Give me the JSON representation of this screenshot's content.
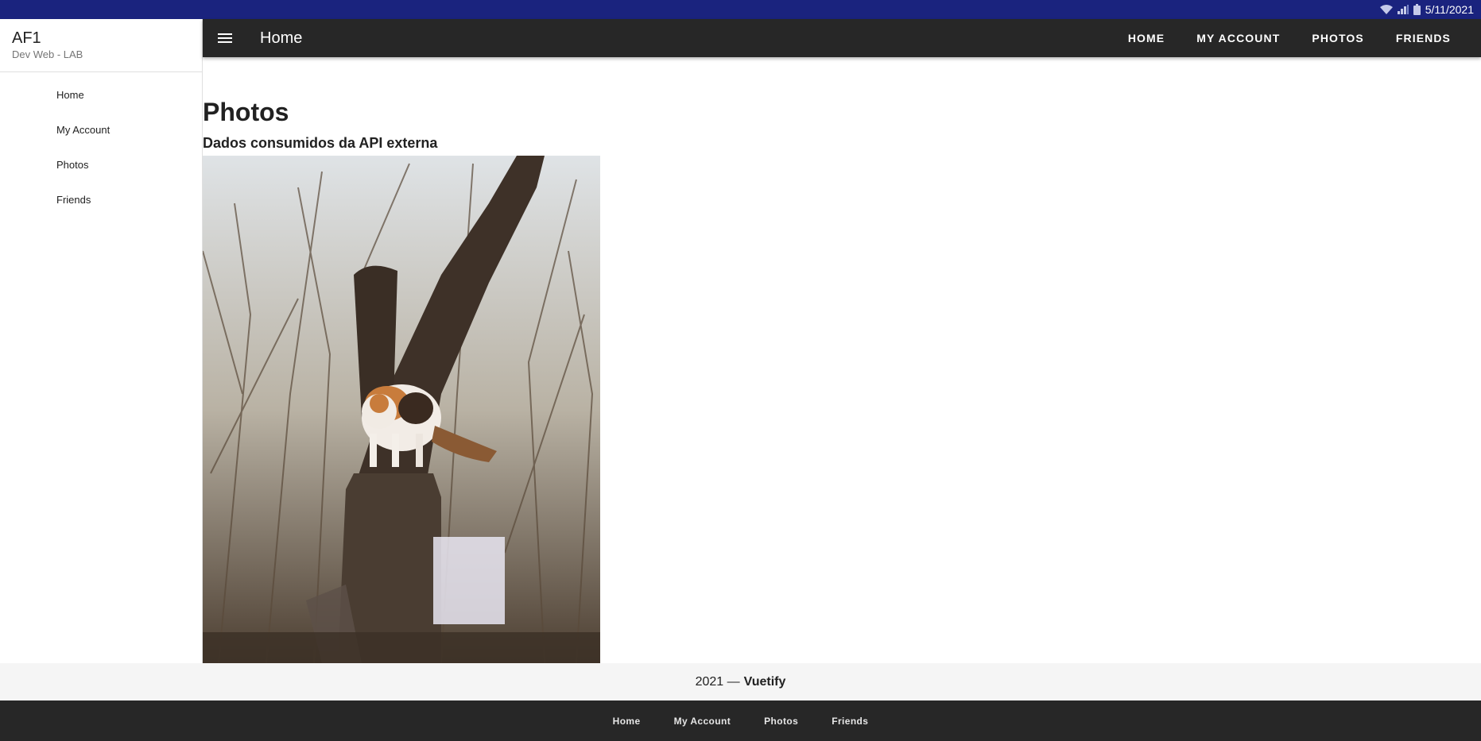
{
  "status_bar": {
    "date": "5/11/2021",
    "icons": [
      "wifi-icon",
      "signal-icon",
      "battery-icon"
    ]
  },
  "drawer": {
    "title": "AF1",
    "subtitle": "Dev Web - LAB",
    "items": [
      {
        "label": "Home"
      },
      {
        "label": "My Account"
      },
      {
        "label": "Photos"
      },
      {
        "label": "Friends"
      }
    ]
  },
  "appbar": {
    "menu_icon": "hamburger-menu-icon",
    "title": "Home",
    "nav": [
      {
        "label": "HOME"
      },
      {
        "label": "MY ACCOUNT"
      },
      {
        "label": "PHOTOS"
      },
      {
        "label": "FRIENDS"
      }
    ]
  },
  "main": {
    "title": "Photos",
    "subtitle": "Dados consumidos da API externa",
    "photo": {
      "subject": "cat-on-tree-stump-photo"
    }
  },
  "footer": {
    "year_text": "2021 —",
    "brand": "Vuetify"
  },
  "bottom_nav": [
    {
      "label": "Home"
    },
    {
      "label": "My Account"
    },
    {
      "label": "Photos"
    },
    {
      "label": "Friends"
    }
  ],
  "colors": {
    "status_bar": "#1a237e",
    "app_bar": "#272727",
    "footer": "#f5f5f5",
    "bottom_nav": "#272727"
  }
}
